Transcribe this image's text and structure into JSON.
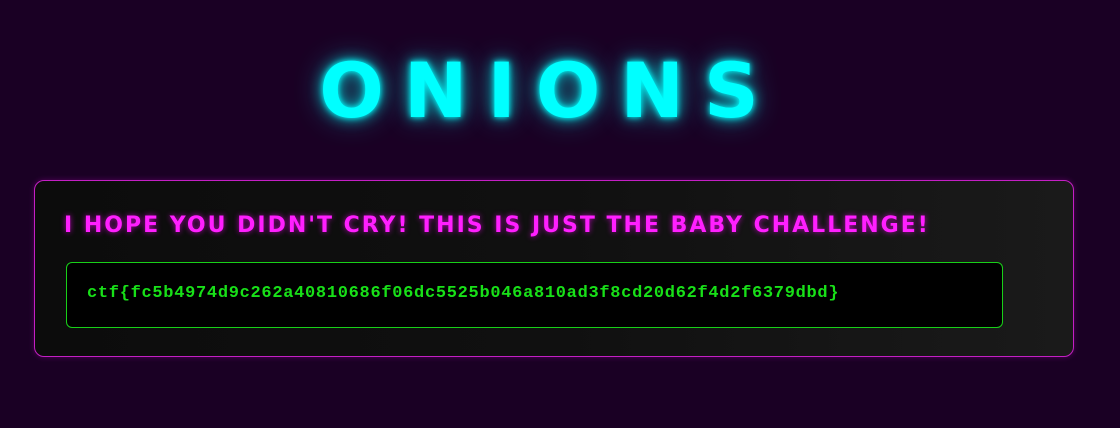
{
  "page": {
    "title": "ONIONS"
  },
  "panel": {
    "message": "I HOPE YOU DIDN'T CRY! THIS IS JUST THE BABY CHALLENGE!",
    "flag": "ctf{fc5b4974d9c262a40810686f06dc5525b046a810ad3f8cd20d62f4d2f6379dbd}"
  },
  "colors": {
    "background": "#1a0024",
    "title_glow": "#00ffff",
    "message": "#ff1fff",
    "flag_text": "#18e018",
    "panel_border": "#c41fc4",
    "flag_border": "#18d018"
  }
}
